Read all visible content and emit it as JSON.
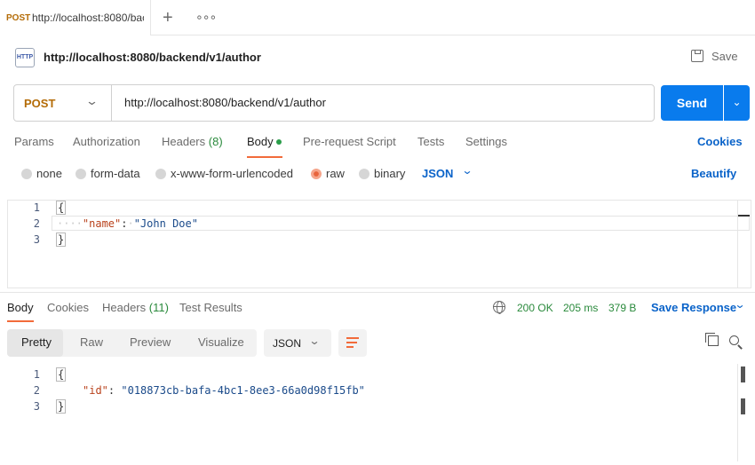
{
  "tabbar": {
    "tab": {
      "method": "POST",
      "title": "http://localhost:8080/backend/v1/author"
    },
    "new_tab": "+",
    "more": "∘∘∘"
  },
  "request": {
    "icon_text": "HTTP",
    "title": "http://localhost:8080/backend/v1/author",
    "save_label": "Save",
    "method": "POST",
    "url": "http://localhost:8080/backend/v1/author",
    "send_label": "Send"
  },
  "request_tabs": {
    "params": "Params",
    "authorization": "Authorization",
    "headers": "Headers",
    "headers_count": "(8)",
    "body": "Body",
    "prerequest": "Pre-request Script",
    "tests": "Tests",
    "settings": "Settings",
    "cookies": "Cookies"
  },
  "body_types": {
    "none": "none",
    "form_data": "form-data",
    "urlencoded": "x-www-form-urlencoded",
    "raw": "raw",
    "binary": "binary",
    "format": "JSON",
    "beautify": "Beautify",
    "selected": "raw"
  },
  "request_body": {
    "lines": [
      "1",
      "2",
      "3"
    ],
    "open": "{",
    "key": "\"name\"",
    "colon": ":",
    "value": "\"John Doe\"",
    "close": "}"
  },
  "response_tabs": {
    "body": "Body",
    "cookies": "Cookies",
    "headers": "Headers",
    "headers_count": "(11)",
    "test_results": "Test Results"
  },
  "response_status": {
    "code": "200 OK",
    "time": "205 ms",
    "size": "379 B",
    "save_response": "Save Response"
  },
  "response_view": {
    "pretty": "Pretty",
    "raw": "Raw",
    "preview": "Preview",
    "visualize": "Visualize",
    "format": "JSON"
  },
  "response_body": {
    "lines": [
      "1",
      "2",
      "3"
    ],
    "open": "{",
    "key": "\"id\"",
    "colon": ":",
    "value": "\"018873cb-bafa-4bc1-8ee3-66a0d98f15fb\"",
    "close": "}"
  },
  "colors": {
    "accent": "#097bed",
    "method_post": "#b46c07",
    "active_underline": "#f26b3a",
    "status_ok": "#2a8a3c",
    "link": "#0a63c9"
  },
  "icons": [
    "http-icon",
    "save-icon",
    "chevron-down-icon",
    "globe-icon",
    "wrap-lines-icon",
    "copy-icon",
    "search-icon"
  ]
}
